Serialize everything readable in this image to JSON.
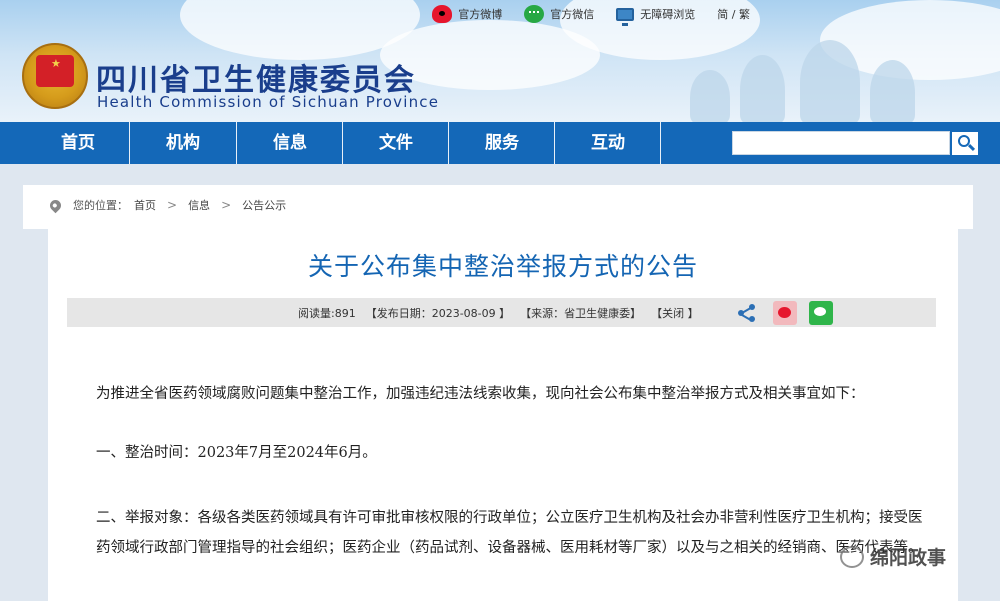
{
  "header": {
    "toplinks": [
      {
        "label": "官方微博",
        "icon": "weibo-icon"
      },
      {
        "label": "官方微信",
        "icon": "wechat-icon"
      },
      {
        "label": "无障碍浏览",
        "icon": "monitor-icon"
      },
      {
        "label": "简 / 繁"
      }
    ],
    "title": "四川省卫生健康委员会",
    "subtitle": "Health Commission of Sichuan Province"
  },
  "nav": {
    "items": [
      "首页",
      "机构",
      "信息",
      "文件",
      "服务",
      "互动"
    ],
    "search_placeholder": ""
  },
  "breadcrumb": {
    "label": "您的位置：",
    "items": [
      "首页",
      "信息",
      "公告公示"
    ]
  },
  "article": {
    "title": "关于公布集中整治举报方式的公告",
    "meta": {
      "views": "阅读量:891",
      "date": "【发布日期：2023-08-09 】",
      "source": "【来源：省卫生健康委】",
      "close": "【关闭 】"
    },
    "paragraphs": [
      "为推进全省医药领域腐败问题集中整治工作，加强违纪违法线索收集，现向社会公布集中整治举报方式及相关事宜如下：",
      "一、整治时间：2023年7月至2024年6月。",
      "二、举报对象：各级各类医药领域具有许可审批审核权限的行政单位；公立医疗卫生机构及社会办非营利性医疗卫生机构；接受医药领域行政部门管理指导的社会组织；医药企业（药品试剂、设备器械、医用耗材等厂家）以及与之相关的经销商、医药代表等。"
    ]
  },
  "watermark": "绵阳政事",
  "colors": {
    "nav_bg": "#1468b8",
    "title_blue": "#1465b3",
    "brand_navy": "#1a3e8c"
  }
}
